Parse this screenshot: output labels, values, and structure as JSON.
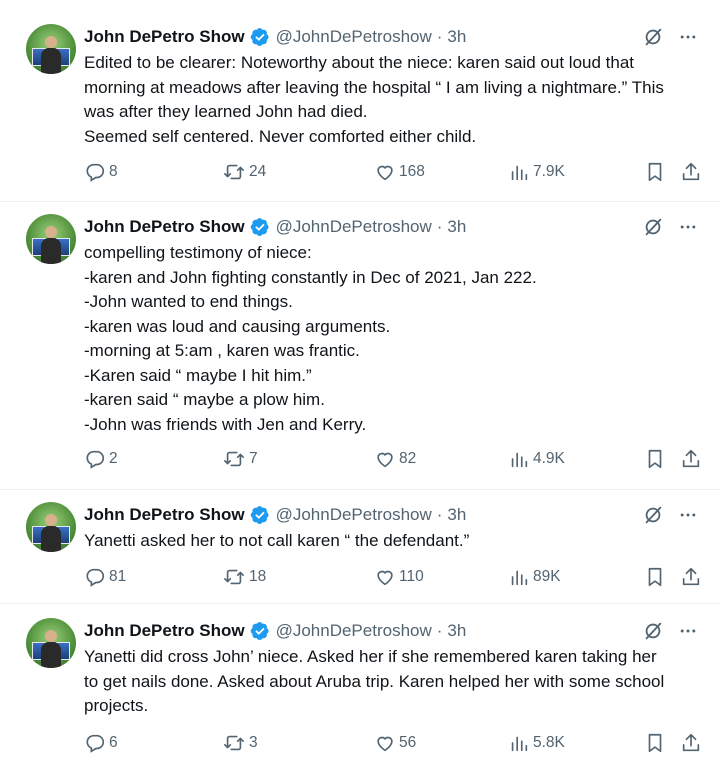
{
  "tweets": [
    {
      "author": "John DePetro Show",
      "handle": "@JohnDePetroshow",
      "time": "3h",
      "lines": [
        "Edited to be clearer: Noteworthy about the niece: karen said out loud that",
        "morning at meadows after leaving the hospital “ I am living a nightmare.” This",
        "was after they learned John had died.",
        "Seemed self centered. Never comforted either child."
      ],
      "replies": "8",
      "retweets": "24",
      "likes": "168",
      "views": "7.9K"
    },
    {
      "author": "John DePetro Show",
      "handle": "@JohnDePetroshow",
      "time": "3h",
      "lines": [
        "compelling testimony of niece:",
        "-karen and John fighting constantly in Dec of 2021, Jan 222.",
        "-John wanted to end things.",
        "-karen was loud and causing arguments.",
        "-morning at 5:am , karen was frantic.",
        "-Karen said “ maybe I hit him.”",
        "-karen said “ maybe a plow him.",
        "-John was friends with Jen and Kerry."
      ],
      "replies": "2",
      "retweets": "7",
      "likes": "82",
      "views": "4.9K"
    },
    {
      "author": "John DePetro Show",
      "handle": "@JohnDePetroshow",
      "time": "3h",
      "lines": [
        "Yanetti asked her to not call karen “ the defendant.”"
      ],
      "replies": "81",
      "retweets": "18",
      "likes": "110",
      "views": "89K"
    },
    {
      "author": "John DePetro Show",
      "handle": "@JohnDePetroshow",
      "time": "3h",
      "lines": [
        "Yanetti did cross John’ niece. Asked her if she remembered karen taking her",
        "to get nails done. Asked about Aruba trip. Karen helped her with some school",
        "projects."
      ],
      "replies": "6",
      "retweets": "3",
      "likes": "56",
      "views": "5.8K"
    }
  ],
  "dot_separator": "·",
  "colors": {
    "text": "#0f1419",
    "secondary": "#536471",
    "verified": "#1d9bf0",
    "divider": "#eff3f4"
  },
  "icons": [
    "verified-badge-icon",
    "grok-icon",
    "more-icon",
    "reply-icon",
    "retweet-icon",
    "like-icon",
    "views-icon",
    "bookmark-icon",
    "share-icon"
  ]
}
